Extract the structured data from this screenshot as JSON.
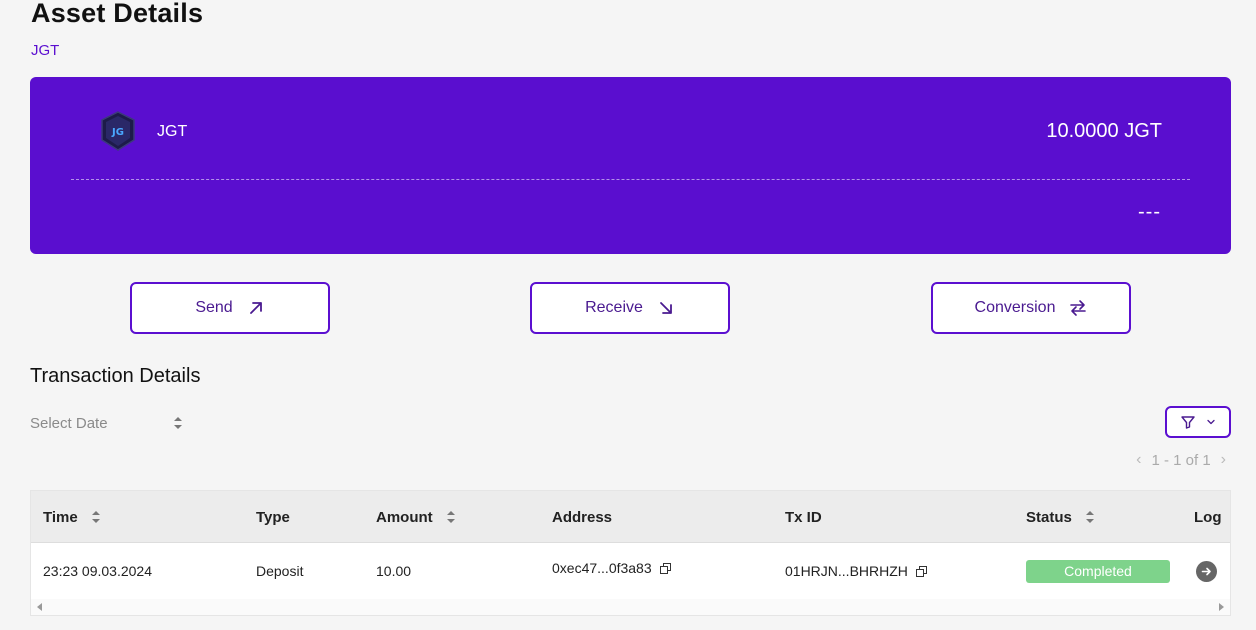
{
  "page": {
    "title": "Asset Details",
    "breadcrumb": "JGT"
  },
  "asset": {
    "symbol": "JGT",
    "logo_text": "JG",
    "balance": "10.0000 JGT",
    "fiat_value": "---",
    "card_color": "#5a0ecf"
  },
  "actions": {
    "send": {
      "label": "Send",
      "icon": "arrow-up-right-icon"
    },
    "receive": {
      "label": "Receive",
      "icon": "arrow-down-right-icon"
    },
    "conversion": {
      "label": "Conversion",
      "icon": "swap-arrows-icon"
    }
  },
  "transactions": {
    "title": "Transaction Details",
    "date_filter": {
      "placeholder": "Select Date"
    },
    "filter_icon": "filter-icon",
    "pagination": {
      "label": "1 - 1 of 1"
    },
    "columns": [
      "Time",
      "Type",
      "Amount",
      "Address",
      "Tx ID",
      "Status",
      "Log"
    ],
    "rows": [
      {
        "time": "23:23 09.03.2024",
        "type": "Deposit",
        "amount": "10.00",
        "address": "0xec47...0f3a83",
        "tx_id": "01HRJN...BHRHZH",
        "status": "Completed",
        "status_color": "#7ed38b"
      }
    ]
  },
  "colors": {
    "accent": "#5b0fd0",
    "text_accent": "#4a1a90"
  }
}
